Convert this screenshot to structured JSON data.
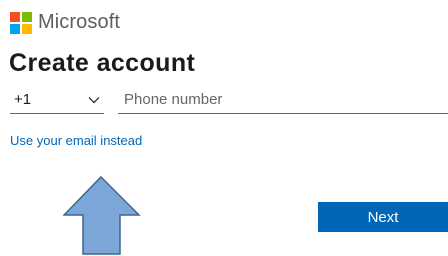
{
  "brand": {
    "name": "Microsoft",
    "logo_icon": "microsoft-logo-icon",
    "logo_colors": [
      "#f25022",
      "#7fba00",
      "#00a4ef",
      "#ffb900"
    ]
  },
  "page": {
    "title": "Create account"
  },
  "phone": {
    "country_code": "+1",
    "chevron_icon": "chevron-down-icon",
    "placeholder": "Phone number",
    "value": ""
  },
  "links": {
    "use_email": "Use your email instead"
  },
  "annotation": {
    "icon": "up-arrow-icon",
    "color": "#7da7d9"
  },
  "actions": {
    "next_label": "Next"
  },
  "colors": {
    "accent": "#0067b8",
    "text": "#1b1b1b",
    "muted": "#666666"
  }
}
